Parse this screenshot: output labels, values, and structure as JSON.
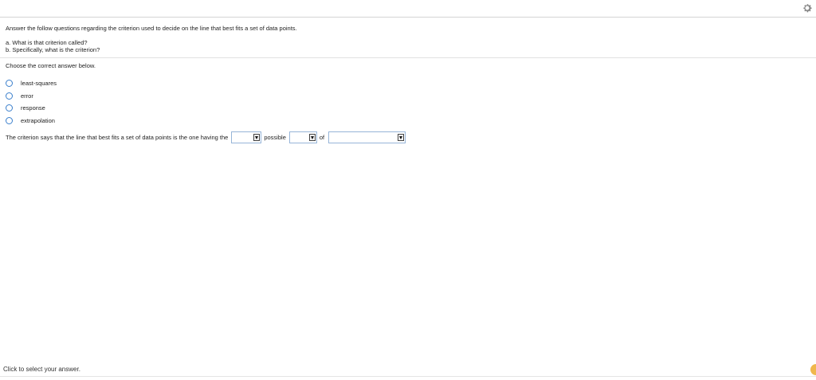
{
  "header": {
    "settings_icon": "gear-icon"
  },
  "question": {
    "text": "Answer the follow questions regarding the criterion used to decide on the line that best fits a set of data points.",
    "part_a": "a. What is that criterion called?",
    "part_b": "b. Specifically, what is the criterion?"
  },
  "part_a_prompt": "Choose the correct answer below.",
  "options": [
    {
      "label": "least-squares"
    },
    {
      "label": "error"
    },
    {
      "label": "response"
    },
    {
      "label": "extrapolation"
    }
  ],
  "part_b_sentence": {
    "before": "The criterion says that the line that best fits a set of data points is the one having the",
    "select1_value": "",
    "middle": "possible",
    "select2_value": "",
    "after": "of",
    "select3_value": ""
  },
  "footer": {
    "status": "Click to select your answer."
  },
  "colors": {
    "radio_border": "#3a7fcc",
    "select_border": "#97b5d8",
    "help_dot": "#f0b74c"
  }
}
